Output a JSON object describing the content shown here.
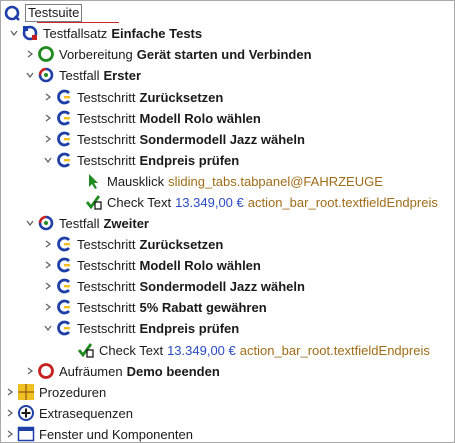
{
  "tree": {
    "root_label": "Testsuite",
    "testset": {
      "prefix": "Testfallsatz",
      "name": "Einfache Tests"
    },
    "setup": {
      "prefix": "Vorbereitung",
      "name": "Gerät starten und Verbinden"
    },
    "case1": {
      "prefix": "Testfall",
      "name": "Erster",
      "steps": [
        {
          "prefix": "Testschritt",
          "name": "Zurücksetzen"
        },
        {
          "prefix": "Testschritt",
          "name": "Modell Rolo wählen"
        },
        {
          "prefix": "Testschritt",
          "name": "Sondermodell Jazz wäheln"
        },
        {
          "prefix": "Testschritt",
          "name": "Endpreis prüfen"
        }
      ],
      "click": {
        "prefix": "Mausklick",
        "target": "sliding_tabs.tabpanel@FAHRZEUGE"
      },
      "check": {
        "prefix": "Check Text",
        "value": "13.349,00 €",
        "target": "action_bar_root.textfieldEndpreis"
      }
    },
    "case2": {
      "prefix": "Testfall",
      "name": "Zweiter",
      "steps": [
        {
          "prefix": "Testschritt",
          "name": "Zurücksetzen"
        },
        {
          "prefix": "Testschritt",
          "name": "Modell Rolo wählen"
        },
        {
          "prefix": "Testschritt",
          "name": "Sondermodell Jazz wäheln"
        },
        {
          "prefix": "Testschritt",
          "name": "5% Rabatt gewähren"
        },
        {
          "prefix": "Testschritt",
          "name": "Endpreis prüfen"
        }
      ],
      "check": {
        "prefix": "Check Text",
        "value": "13.349,00 €",
        "target": "action_bar_root.textfieldEndpreis"
      }
    },
    "cleanup": {
      "prefix": "Aufräumen",
      "name": "Demo beenden"
    },
    "procedures": "Prozeduren",
    "extras": "Extrasequenzen",
    "windows": "Fenster und Komponenten"
  },
  "icons": {
    "suite": "testsuite-icon",
    "testset": "testset-icon",
    "setup": "setup-icon",
    "testcase": "testcase-icon",
    "teststep": "teststep-icon",
    "mouseclick": "mouse-click-icon",
    "check": "check-text-icon",
    "cleanup": "cleanup-icon",
    "procedures": "procedures-icon",
    "extras": "extras-icon",
    "windows": "windows-components-icon"
  },
  "colors": {
    "selection_border": "#7d7d7d",
    "accent_blue": "#1f3fa8",
    "accent_red": "#c62020",
    "accent_green": "#1f8a1f",
    "accent_yellow": "#f0c020",
    "value_blue": "#2b4cc4",
    "target_brown": "#a06c18"
  }
}
